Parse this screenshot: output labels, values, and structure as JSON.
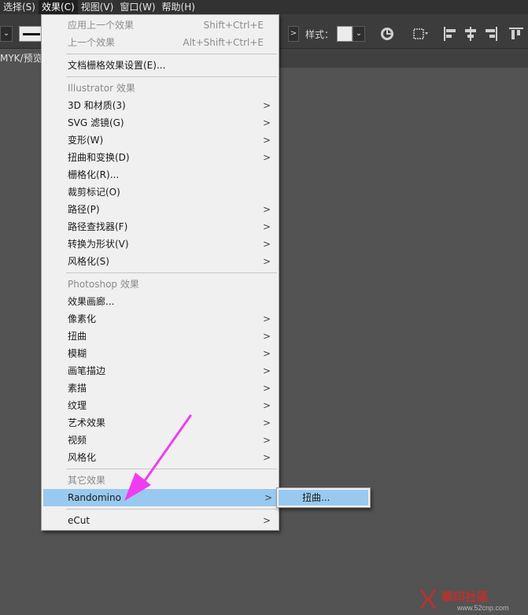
{
  "menubar": {
    "items": [
      "选择(S)",
      "效果(C)",
      "视图(V)",
      "窗口(W)",
      "帮助(H)"
    ]
  },
  "controlbar": {
    "style_label": "样式：",
    "stroke_dd": "⌄",
    "arrow": ">",
    "style_dd": "⌄"
  },
  "doc_tab": {
    "label": "MYK/预览)"
  },
  "effect_menu": {
    "apply_last": {
      "label": "应用上一个效果",
      "shortcut": "Shift+Ctrl+E"
    },
    "last": {
      "label": "上一个效果",
      "shortcut": "Alt+Shift+Ctrl+E"
    },
    "raster_settings": "文档栅格效果设置(E)...",
    "illustrator_header": "Illustrator 效果",
    "illustrator_items": [
      {
        "label": "3D 和材质(3)",
        "sub": ">"
      },
      {
        "label": "SVG 滤镜(G)",
        "sub": ">"
      },
      {
        "label": "变形(W)",
        "sub": ">"
      },
      {
        "label": "扭曲和变换(D)",
        "sub": ">"
      },
      {
        "label": "栅格化(R)...",
        "sub": ""
      },
      {
        "label": "裁剪标记(O)",
        "sub": ""
      },
      {
        "label": "路径(P)",
        "sub": ">"
      },
      {
        "label": "路径查找器(F)",
        "sub": ">"
      },
      {
        "label": "转换为形状(V)",
        "sub": ">"
      },
      {
        "label": "风格化(S)",
        "sub": ">"
      }
    ],
    "photoshop_header": "Photoshop 效果",
    "photoshop_items": [
      {
        "label": "效果画廊...",
        "sub": ""
      },
      {
        "label": "像素化",
        "sub": ">"
      },
      {
        "label": "扭曲",
        "sub": ">"
      },
      {
        "label": "模糊",
        "sub": ">"
      },
      {
        "label": "画笔描边",
        "sub": ">"
      },
      {
        "label": "素描",
        "sub": ">"
      },
      {
        "label": "纹理",
        "sub": ">"
      },
      {
        "label": "艺术效果",
        "sub": ">"
      },
      {
        "label": "视频",
        "sub": ">"
      },
      {
        "label": "风格化",
        "sub": ">"
      }
    ],
    "other_header": "其它效果",
    "randomino": {
      "label": "Randomino",
      "sub": ">"
    },
    "ecut": {
      "label": "eCut",
      "sub": ">"
    }
  },
  "submenu": {
    "item": "扭曲..."
  },
  "watermark": {
    "text": "華印社區",
    "url": "www.52cnp.com"
  },
  "colors": {
    "highlight": "#99c9ef",
    "annotation_arrow": "#f03cf0"
  }
}
